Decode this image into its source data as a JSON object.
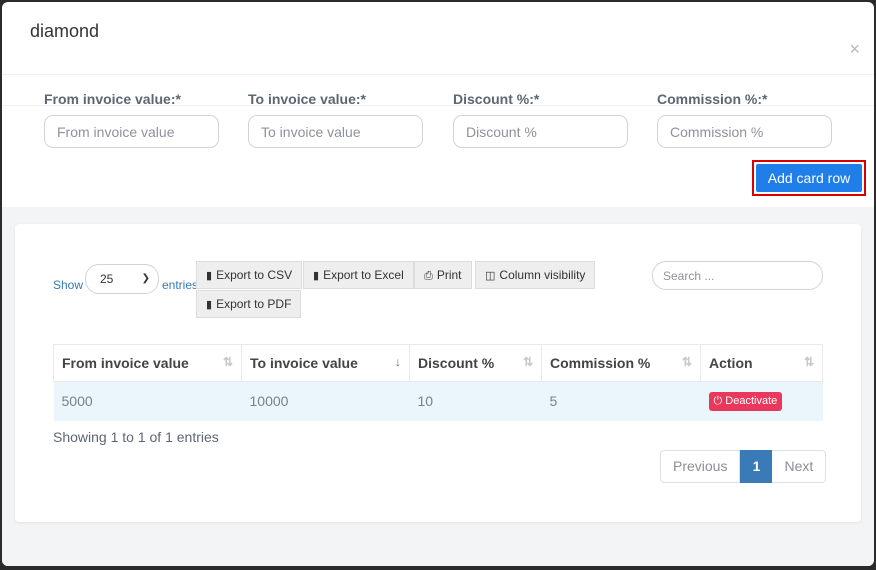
{
  "modal": {
    "title": "diamond",
    "close_symbol": "×"
  },
  "form": {
    "fields": [
      {
        "label": "From invoice value:*",
        "placeholder": "From invoice value"
      },
      {
        "label": "To invoice value:*",
        "placeholder": "To invoice value"
      },
      {
        "label": "Discount %:*",
        "placeholder": "Discount %"
      },
      {
        "label": "Commission %:*",
        "placeholder": "Commission %"
      }
    ],
    "add_button": "Add card row"
  },
  "table_controls": {
    "show_label": "Show",
    "page_length": "25",
    "entries_label": "entries",
    "buttons": [
      {
        "label": "Export to CSV",
        "icon": "file-csv-icon"
      },
      {
        "label": "Export to Excel",
        "icon": "file-excel-icon"
      },
      {
        "label": "Print",
        "icon": "print-icon"
      },
      {
        "label": "Column visibility",
        "icon": "columns-icon"
      },
      {
        "label": "Export to PDF",
        "icon": "file-pdf-icon"
      }
    ],
    "search_placeholder": "Search ..."
  },
  "table": {
    "columns": [
      "From invoice value",
      "To invoice value",
      "Discount %",
      "Commission %",
      "Action"
    ],
    "rows": [
      {
        "from": "5000",
        "to": "10000",
        "discount": "10",
        "commission": "5",
        "action": "Deactivate"
      }
    ]
  },
  "footer": {
    "info": "Showing 1 to 1 of 1 entries",
    "previous": "Previous",
    "current_page": "1",
    "next": "Next"
  },
  "colors": {
    "primary": "#1f7ee8",
    "danger": "#e8385b",
    "pager_active": "#3a7ab6",
    "highlight_border": "#d90000"
  }
}
